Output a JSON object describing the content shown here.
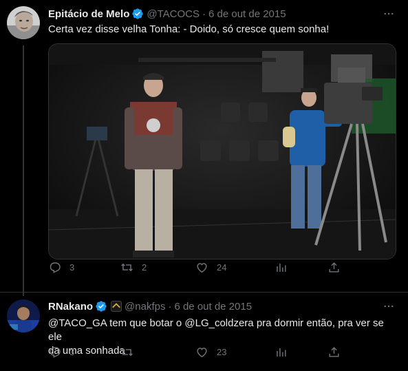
{
  "tweets": [
    {
      "author_name": "Epitácio de Melo",
      "handle": "@TACOCS",
      "separator": "·",
      "date": "6 de out de 2015",
      "text": "Certa vez disse velha Tonha: - Doido, só cresce quem sonha!",
      "actions": {
        "replies": "3",
        "retweets": "2",
        "likes": "24"
      }
    },
    {
      "author_name": "RNakano",
      "handle": "@nakfps",
      "separator": "·",
      "date": "6 de out de 2015",
      "text_part1": "@TACO_GA tem que botar o @LG_coldzera pra dormir então, pra ver se ele",
      "text_part2": "da uma sonhada",
      "actions": {
        "replies": "3",
        "retweets": "",
        "likes": "23"
      }
    }
  ],
  "colors": {
    "background": "#000000",
    "text": "#e7e9ea",
    "muted": "#71767b",
    "verified": "#1d9bf0",
    "border": "#2f3336"
  },
  "icons": [
    "reply-icon",
    "retweet-icon",
    "like-icon",
    "analytics-icon",
    "share-icon",
    "verified-icon",
    "more-icon"
  ]
}
